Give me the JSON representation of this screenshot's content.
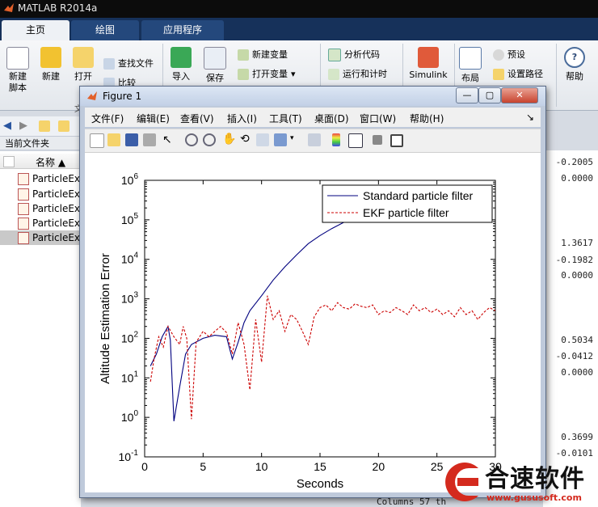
{
  "matlab": {
    "title": "MATLAB R2014a",
    "tabs": [
      "主页",
      "绘图",
      "应用程序"
    ],
    "ribbon": {
      "new_script": "新建\n脚本",
      "new": "新建",
      "open": "打开",
      "find_files": "查找文件",
      "compare": "比较",
      "file_section": "文",
      "import": "导入",
      "save": "保存",
      "new_variable": "新建变量",
      "open_variable": "打开变量",
      "analyze_code": "分析代码",
      "run_and_time": "运行和计时",
      "simulink": "Simulink",
      "layout": "布局",
      "preferences": "预设",
      "set_path": "设置路径",
      "help": "帮助"
    },
    "current_folder": "当前文件夹",
    "name_column": "名称 ▲",
    "files": [
      "ParticleEx",
      "ParticleEx",
      "ParticleEx",
      "ParticleEx",
      "ParticleEx"
    ],
    "command_values": [
      "-0.2005",
      "0.0000",
      "1.3617",
      "-0.1982",
      "0.0000",
      "0.5034",
      "-0.0412",
      "0.0000",
      "0.3699",
      "-0.0101"
    ],
    "command_footer": "Columns 57 th"
  },
  "figure": {
    "title": "Figure 1",
    "menus": [
      "文件(F)",
      "编辑(E)",
      "查看(V)",
      "插入(I)",
      "工具(T)",
      "桌面(D)",
      "窗口(W)",
      "帮助(H)"
    ],
    "win_min": "—",
    "win_max": "▢",
    "win_close": "✕",
    "menu_arrow": "↘"
  },
  "chart_data": {
    "type": "line",
    "xlabel": "Seconds",
    "ylabel": "Altitude Estimation Error",
    "xlim": [
      0,
      30
    ],
    "ylim": [
      0.1,
      1000000
    ],
    "yscale": "log",
    "x_ticks": [
      "0",
      "5",
      "10",
      "15",
      "20",
      "25",
      "30"
    ],
    "y_ticks": [
      "10",
      "10",
      "10",
      "10",
      "10",
      "10",
      "10",
      "10"
    ],
    "y_tick_exponents": [
      "6",
      "5",
      "4",
      "3",
      "2",
      "1",
      "0",
      "-1"
    ],
    "y_tick_values": [
      1000000,
      100000,
      10000,
      1000,
      100,
      10,
      1,
      0.1
    ],
    "legend_position": "top-right",
    "grid": false,
    "series": [
      {
        "name": "Standard particle filter",
        "color": "#00007f",
        "style": "solid",
        "points": [
          [
            0.5,
            20
          ],
          [
            1,
            40
          ],
          [
            1.5,
            110
          ],
          [
            2,
            200
          ],
          [
            2.2,
            90
          ],
          [
            2.5,
            0.8
          ],
          [
            3,
            6
          ],
          [
            3.5,
            40
          ],
          [
            4,
            70
          ],
          [
            5,
            100
          ],
          [
            6,
            120
          ],
          [
            7,
            110
          ],
          [
            7.5,
            30
          ],
          [
            8,
            80
          ],
          [
            8.5,
            250
          ],
          [
            9,
            500
          ],
          [
            10,
            1200
          ],
          [
            11,
            3000
          ],
          [
            12,
            6500
          ],
          [
            13,
            13000
          ],
          [
            14,
            25000
          ],
          [
            15,
            40000
          ],
          [
            16,
            60000
          ],
          [
            17,
            85000
          ],
          [
            17.6,
            100000
          ]
        ]
      },
      {
        "name": "EKF particle filter",
        "color": "#cc0000",
        "style": "dashed",
        "points": [
          [
            0.5,
            8
          ],
          [
            0.8,
            30
          ],
          [
            1.2,
            110
          ],
          [
            1.6,
            60
          ],
          [
            2,
            200
          ],
          [
            2.5,
            110
          ],
          [
            3,
            70
          ],
          [
            3.3,
            200
          ],
          [
            3.6,
            100
          ],
          [
            4,
            0.9
          ],
          [
            4.4,
            80
          ],
          [
            5,
            150
          ],
          [
            5.5,
            110
          ],
          [
            6,
            150
          ],
          [
            6.5,
            200
          ],
          [
            7,
            140
          ],
          [
            7.5,
            40
          ],
          [
            8,
            250
          ],
          [
            8.5,
            70
          ],
          [
            9,
            5
          ],
          [
            9.5,
            300
          ],
          [
            10,
            25
          ],
          [
            10.5,
            1200
          ],
          [
            11,
            300
          ],
          [
            11.5,
            500
          ],
          [
            12,
            150
          ],
          [
            12.5,
            400
          ],
          [
            13,
            300
          ],
          [
            13.5,
            150
          ],
          [
            14,
            70
          ],
          [
            14.5,
            350
          ],
          [
            15,
            600
          ],
          [
            15.5,
            700
          ],
          [
            16,
            500
          ],
          [
            16.5,
            800
          ],
          [
            17,
            600
          ],
          [
            17.5,
            550
          ],
          [
            18,
            750
          ],
          [
            18.5,
            650
          ],
          [
            19,
            600
          ],
          [
            19.5,
            700
          ],
          [
            20,
            400
          ],
          [
            20.5,
            500
          ],
          [
            21,
            450
          ],
          [
            21.5,
            600
          ],
          [
            22,
            500
          ],
          [
            22.5,
            400
          ],
          [
            23,
            700
          ],
          [
            23.5,
            500
          ],
          [
            24,
            600
          ],
          [
            24.5,
            450
          ],
          [
            25,
            550
          ],
          [
            25.5,
            400
          ],
          [
            26,
            500
          ],
          [
            26.5,
            350
          ],
          [
            27,
            600
          ],
          [
            27.5,
            400
          ],
          [
            28,
            500
          ],
          [
            28.5,
            300
          ],
          [
            29,
            450
          ],
          [
            29.5,
            600
          ],
          [
            30,
            500
          ]
        ]
      }
    ]
  },
  "watermark": {
    "name": "合速软件",
    "url": "www.gususoft.com"
  },
  "colors": {
    "matlab_tabbar": "#16315a",
    "standard_line": "#00007f",
    "ekf_line": "#cc0000",
    "watermark_red": "#d42a1e"
  }
}
